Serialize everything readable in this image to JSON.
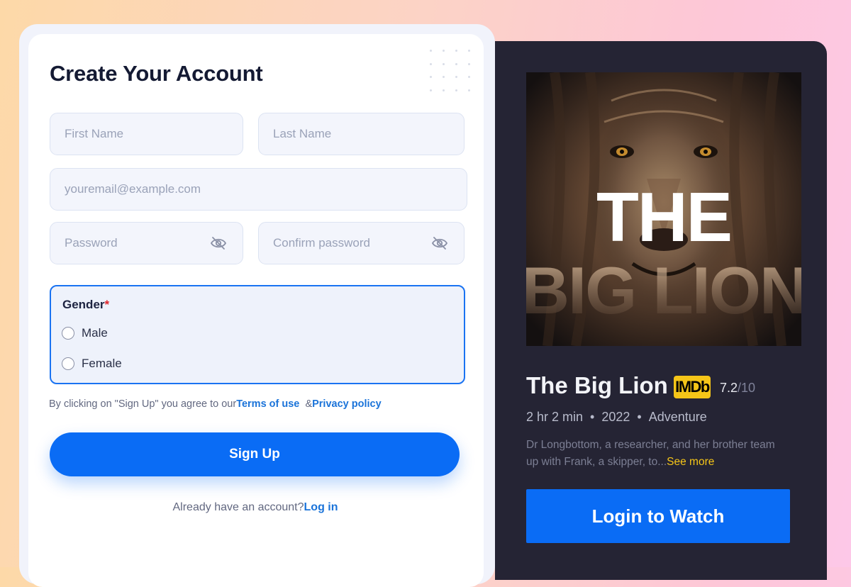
{
  "form": {
    "title": "Create Your Account",
    "first_name_placeholder": "First Name",
    "last_name_placeholder": "Last Name",
    "email_placeholder": "youremail@example.com",
    "password_placeholder": "Password",
    "confirm_password_placeholder": "Confirm password",
    "gender": {
      "label": "Gender",
      "required_mark": "*",
      "options": [
        "Male",
        "Female"
      ]
    },
    "agreement": {
      "prefix": "By clicking on \"Sign Up\" you agree to our",
      "terms_label": "Terms of use",
      "connector": "&",
      "privacy_label": "Privacy policy"
    },
    "signup_label": "Sign Up",
    "login_prompt": "Already have an account?",
    "login_link": "Log in"
  },
  "movie": {
    "poster_title_line1": "THE",
    "poster_title_line2": "BIG LION",
    "title": "The Big Lion",
    "imdb_badge": "IMDb",
    "rating": "7.2",
    "rating_scale": "/10",
    "duration": "2 hr 2 min",
    "year": "2022",
    "genre": "Adventure",
    "meta_separator": "•",
    "description": "Dr Longbottom, a researcher, and her brother team up with Frank, a skipper, to...",
    "see_more": "See more",
    "login_button": "Login to Watch"
  },
  "colors": {
    "accent": "#0a6cf5",
    "panel_bg": "#252434",
    "imdb_yellow": "#f5c518",
    "required_red": "#e0262b"
  },
  "icons": {
    "password_visibility": "eye-off-icon"
  }
}
